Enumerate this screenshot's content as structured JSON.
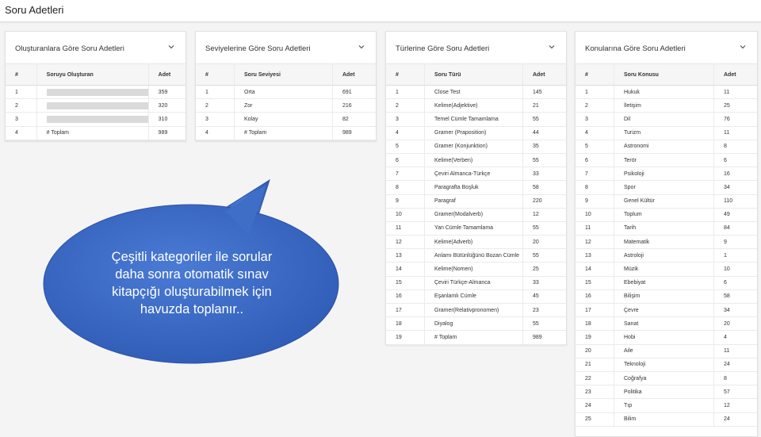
{
  "page": {
    "title": "Soru Adetleri"
  },
  "card1": {
    "title": "Oluşturanlara Göre Soru Adetleri",
    "col_num": "#",
    "col_name": "Soruyu Oluşturan",
    "col_count": "Adet",
    "rows": [
      {
        "num": "1",
        "name": "",
        "count": "359",
        "redacted": true
      },
      {
        "num": "2",
        "name": "",
        "count": "320",
        "redacted": true
      },
      {
        "num": "3",
        "name": "",
        "count": "310",
        "redacted": true
      },
      {
        "num": "4",
        "name": "# Toplam",
        "count": "989",
        "redacted": false
      }
    ]
  },
  "card2": {
    "title": "Seviyelerine Göre Soru Adetleri",
    "col_num": "#",
    "col_name": "Soru Seviyesi",
    "col_count": "Adet",
    "rows": [
      {
        "num": "1",
        "name": "Orta",
        "count": "691"
      },
      {
        "num": "2",
        "name": "Zor",
        "count": "216"
      },
      {
        "num": "3",
        "name": "Kolay",
        "count": "82"
      },
      {
        "num": "4",
        "name": "# Toplam",
        "count": "989"
      }
    ]
  },
  "card3": {
    "title": "Türlerine Göre Soru Adetleri",
    "col_num": "#",
    "col_name": "Soru Türü",
    "col_count": "Adet",
    "rows": [
      {
        "num": "1",
        "name": "Close Test",
        "count": "145"
      },
      {
        "num": "2",
        "name": "Kelime(Adjektive)",
        "count": "21"
      },
      {
        "num": "3",
        "name": "Temel Cümle Tamamlama",
        "count": "55"
      },
      {
        "num": "4",
        "name": "Gramer (Praposition)",
        "count": "44"
      },
      {
        "num": "5",
        "name": "Gramer (Konjunktion)",
        "count": "35"
      },
      {
        "num": "6",
        "name": "Kelime(Verben)",
        "count": "55"
      },
      {
        "num": "7",
        "name": "Çeviri Almanca-Türkçe",
        "count": "33"
      },
      {
        "num": "8",
        "name": "Paragrafta Boşluk",
        "count": "58"
      },
      {
        "num": "9",
        "name": "Paragraf",
        "count": "220"
      },
      {
        "num": "10",
        "name": "Gramer(Modalverb)",
        "count": "12"
      },
      {
        "num": "11",
        "name": "Yan Cümle Tamamlama",
        "count": "55"
      },
      {
        "num": "12",
        "name": "Kelime(Adverb)",
        "count": "20"
      },
      {
        "num": "13",
        "name": "Anlamı Bütünlüğünü Bozan Cümle",
        "count": "55"
      },
      {
        "num": "14",
        "name": "Kelime(Nomen)",
        "count": "25"
      },
      {
        "num": "15",
        "name": "Çeviri Türkçe-Almanca",
        "count": "33"
      },
      {
        "num": "16",
        "name": "Eşanlamlı Cümle",
        "count": "45"
      },
      {
        "num": "17",
        "name": "Gramer(Relativpronomen)",
        "count": "23"
      },
      {
        "num": "18",
        "name": "Diyalog",
        "count": "55"
      },
      {
        "num": "19",
        "name": "# Toplam",
        "count": "989"
      }
    ]
  },
  "card4": {
    "title": "Konularına Göre Soru Adetleri",
    "col_num": "#",
    "col_name": "Soru Konusu",
    "col_count": "Adet",
    "rows": [
      {
        "num": "1",
        "name": "Hukuk",
        "count": "11"
      },
      {
        "num": "2",
        "name": "İletişim",
        "count": "25"
      },
      {
        "num": "3",
        "name": "Dil",
        "count": "76"
      },
      {
        "num": "4",
        "name": "Turizm",
        "count": "11"
      },
      {
        "num": "5",
        "name": "Astronomi",
        "count": "8"
      },
      {
        "num": "6",
        "name": "Terör",
        "count": "6"
      },
      {
        "num": "7",
        "name": "Psikoloji",
        "count": "16"
      },
      {
        "num": "8",
        "name": "Spor",
        "count": "34"
      },
      {
        "num": "9",
        "name": "Genel Kültür",
        "count": "110"
      },
      {
        "num": "10",
        "name": "Toplum",
        "count": "49"
      },
      {
        "num": "11",
        "name": "Tarih",
        "count": "84"
      },
      {
        "num": "12",
        "name": "Matematik",
        "count": "9"
      },
      {
        "num": "13",
        "name": "Astroloji",
        "count": "1"
      },
      {
        "num": "14",
        "name": "Müzik",
        "count": "10"
      },
      {
        "num": "15",
        "name": "Ebebiyat",
        "count": "6"
      },
      {
        "num": "16",
        "name": "Bilişim",
        "count": "58"
      },
      {
        "num": "17",
        "name": "Çevre",
        "count": "34"
      },
      {
        "num": "18",
        "name": "Sanat",
        "count": "20"
      },
      {
        "num": "19",
        "name": "Hobi",
        "count": "4"
      },
      {
        "num": "20",
        "name": "Aile",
        "count": "11"
      },
      {
        "num": "21",
        "name": "Teknoloji",
        "count": "24"
      },
      {
        "num": "22",
        "name": "Coğrafya",
        "count": "8"
      },
      {
        "num": "23",
        "name": "Politika",
        "count": "57"
      },
      {
        "num": "24",
        "name": "Tıp",
        "count": "12"
      },
      {
        "num": "25",
        "name": "Bilim",
        "count": "24"
      }
    ]
  },
  "callout": {
    "lines": [
      "Çeşitli kategoriler ile sorular",
      "daha sonra otomatik sınav",
      "kitapçığı oluşturabilmek için",
      "havuzda toplanır.."
    ],
    "color": "#3f6fc8"
  }
}
